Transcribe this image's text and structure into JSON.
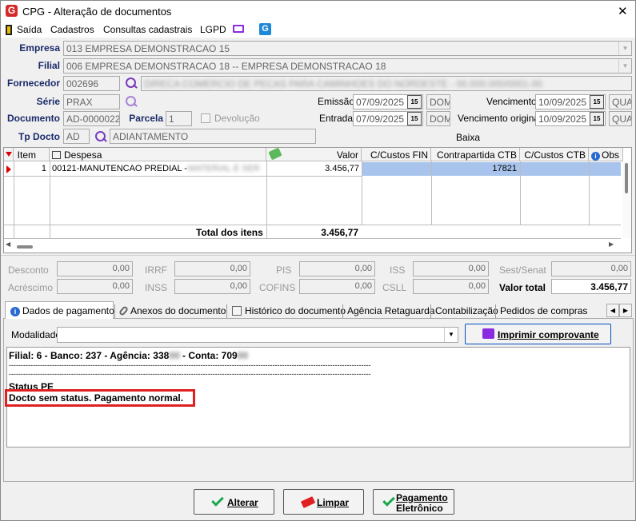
{
  "window": {
    "title": "CPG - Alteração de documentos",
    "close": "✕"
  },
  "menu": {
    "saida": "Saída",
    "cadastros": "Cadastros",
    "consultas": "Consultas cadastrais",
    "lgpd": "LGPD"
  },
  "form": {
    "empresa_label": "Empresa",
    "empresa_value": "013 EMPRESA DEMONSTRACAO 15",
    "filial_label": "Filial",
    "filial_value": "006 EMPRESA DEMONSTRACAO 18 -- EMPRESA DEMONSTRACAO 18",
    "fornecedor_label": "Fornecedor",
    "fornecedor_code": "002696",
    "fornecedor_name": "DIRECA COMERCIO DE PECAS PARA CAMINHOES DO NORDESTE - 00.000.000/0001-00",
    "serie_label": "Série",
    "serie_value": "PRAX",
    "documento_label": "Documento",
    "documento_value": "AD-0000022",
    "parcela_label": "Parcela",
    "parcela_value": "1",
    "devolucao_label": "Devolução",
    "tpdocto_label": "Tp Docto",
    "tpdocto_code": "AD",
    "tpdocto_name": "ADIANTAMENTO",
    "emissao_label": "Emissão",
    "emissao_value": "07/09/2025",
    "emissao_day": "DOM",
    "entrada_label": "Entrada",
    "entrada_value": "07/09/2025",
    "entrada_day": "DOM",
    "vencimento_label": "Vencimento",
    "vencimento_value": "10/09/2025",
    "vencimento_day": "QUA",
    "venc_original_label": "Vencimento original",
    "venc_original_value": "10/09/2025",
    "venc_original_day": "QUA",
    "baixa_label": "Baixa",
    "cal_icon": "15"
  },
  "grid": {
    "headers": {
      "item": "Item",
      "despesa": "Despesa",
      "valor": "Valor",
      "ccfin": "C/Custos FIN",
      "contrapartida": "Contrapartida CTB",
      "ccctb": "C/Custos CTB",
      "obs": "Obs"
    },
    "rows": [
      {
        "item": "1",
        "despesa": "00121-MANUTENCAO PREDIAL -",
        "despesa_extra": "MATERIAL E SER",
        "valor": "3.456,77",
        "contrapartida": "17821"
      }
    ],
    "total_label": "Total dos itens",
    "total_value": "3.456,77"
  },
  "totals": {
    "desconto_label": "Desconto",
    "desconto": "0,00",
    "acrescimo_label": "Acréscimo",
    "acrescimo": "0,00",
    "irrf_label": "IRRF",
    "irrf": "0,00",
    "inss_label": "INSS",
    "inss": "0,00",
    "pis_label": "PIS",
    "pis": "0,00",
    "cofins_label": "COFINS",
    "cofins": "0,00",
    "iss_label": "ISS",
    "iss": "0,00",
    "csll_label": "CSLL",
    "csll": "0,00",
    "sest_label": "Sest/Senat",
    "sest": "0,00",
    "valor_total_label": "Valor total",
    "valor_total": "3.456,77"
  },
  "tabs": [
    "Dados de pagamento",
    "Anexos do documento",
    "Histórico do documento",
    "Agência Retaguarda",
    "Contabilização",
    "Pedidos de compras"
  ],
  "payment": {
    "modalidade_label": "Modalidade",
    "modalidade_value": "",
    "print_button": "Imprimir comprovante",
    "info_line": "Filial: 6 - Banco: 237 - Agência: 338",
    "info_conta": " - Conta: 709",
    "dashes": "-------------------------------------------------------------------------------------------------------------------------------------------------------",
    "status_title": "Status PE",
    "status_text": "Docto sem status. Pagamento normal."
  },
  "buttons": {
    "alterar": "Alterar",
    "limpar": "Limpar",
    "pagamento1": "Pagamento",
    "pagamento2": "Eletrônico"
  },
  "colors": {
    "title_icon": "#d42a2a",
    "label_blue": "#1a2a6a",
    "selected_row": "#a8c4ec",
    "highlight_box": "#e02020"
  }
}
